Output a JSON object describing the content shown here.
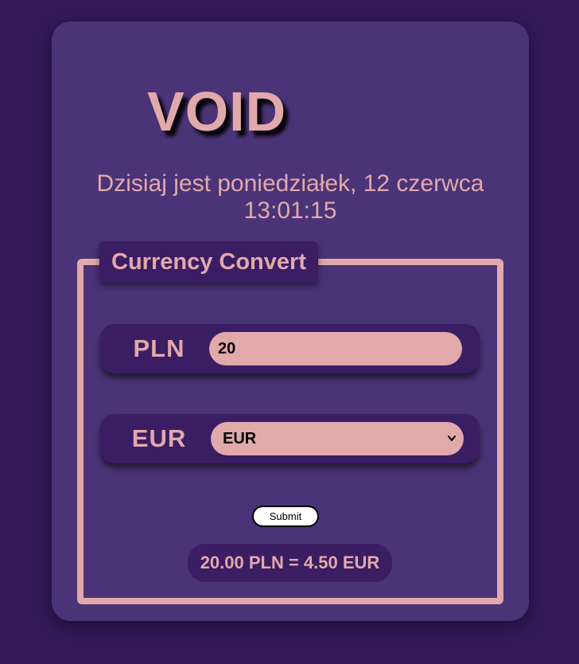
{
  "app": {
    "logo_text": "VOID"
  },
  "header": {
    "date_text": "Dzisiaj jest poniedziałek, 12 czerwca",
    "time_text": "13:01:15"
  },
  "converter": {
    "legend": "Currency Convert",
    "from_label": "PLN",
    "amount_value": "20",
    "to_label": "EUR",
    "selected_currency": "EUR",
    "submit_label": "Submit",
    "result_text": "20.00 PLN = 4.50 EUR"
  },
  "colors": {
    "page_background": "#33195a",
    "card_background": "#4a3477",
    "panel_background": "#3a1d63",
    "accent": "#e2a9ab"
  },
  "icons": {
    "select_arrow": "chevron-down-icon"
  }
}
